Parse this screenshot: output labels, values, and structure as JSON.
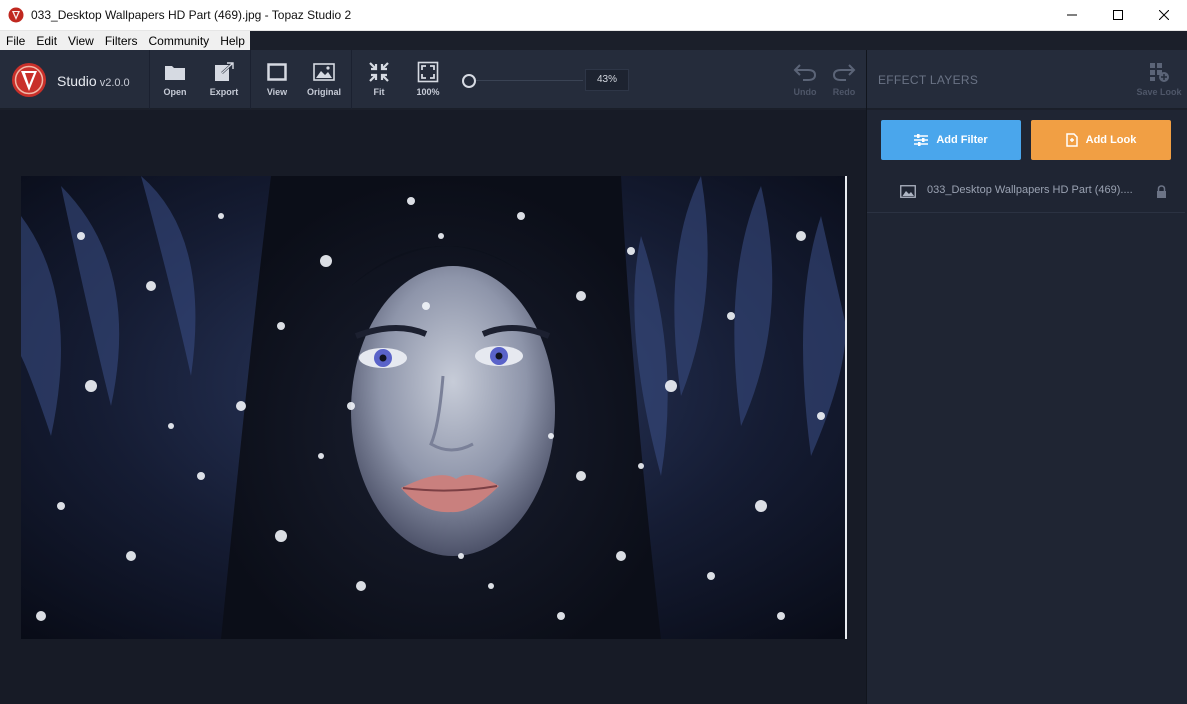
{
  "window": {
    "title": "033_Desktop Wallpapers  HD Part (469).jpg - Topaz Studio 2",
    "controls": [
      "minimize-icon",
      "maximize-icon",
      "close-icon"
    ]
  },
  "menu": [
    "File",
    "Edit",
    "View",
    "Filters",
    "Community",
    "Help"
  ],
  "app": {
    "name": "Studio",
    "version": "v2.0.0"
  },
  "toolbar": {
    "open_label": "Open",
    "export_label": "Export",
    "view_label": "View",
    "original_label": "Original",
    "fit_label": "Fit",
    "hundred_label": "100%",
    "undo_label": "Undo",
    "redo_label": "Redo",
    "zoom_value": "43%"
  },
  "panel": {
    "title": "EFFECT LAYERS",
    "save_look_label": "Save Look",
    "add_filter_label": "Add Filter",
    "add_look_label": "Add Look",
    "layer_name": "033_Desktop Wallpapers  HD Part (469)...."
  },
  "colors": {
    "add_filter": "#4aa6ec",
    "add_look": "#f19f44",
    "logo_red": "#d33a2f"
  }
}
